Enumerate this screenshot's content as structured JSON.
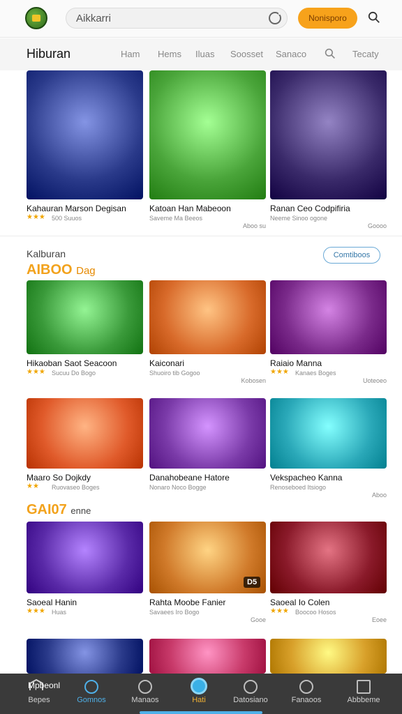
{
  "header": {
    "search_value": "Aikkarri",
    "button_label": "Nonisporo"
  },
  "nav": {
    "title": "Hiburan",
    "links": [
      "Ham",
      "Hems",
      "Iluas",
      "Soosset",
      "Sanaco",
      "Tecaty"
    ]
  },
  "row1": [
    {
      "title": "Kahauran Marson Degisan",
      "meta": "500 Suuos",
      "tag": "",
      "stars": "★★★",
      "bg": "#2a3a8a"
    },
    {
      "title": "Katoan Han Mabeoon",
      "meta": "Saveme Ma Beeos",
      "tag": "Aboo su",
      "stars": "",
      "bg": "#4aa53a"
    },
    {
      "title": "Ranan Ceo Codpifiria",
      "meta": "Neeme Sinoo ogone",
      "tag": "Goooo",
      "stars": "",
      "bg": "#3a2a6a"
    }
  ],
  "section": {
    "subtitle": "Kalburan",
    "heading": "AIBOO",
    "heading_small": "Dag",
    "button": "Comtiboos"
  },
  "row2": [
    {
      "title": "Hikaoban Saot Seacoon",
      "meta": "Sucuu Do Bogo",
      "tag": "",
      "stars": "★★★",
      "bg": "#3a9a3a"
    },
    {
      "title": "Kaiconari",
      "meta": "Shuoiro tib Gogoo",
      "tag": "Kobosen",
      "stars": "",
      "bg": "#d86a2a"
    },
    {
      "title": "Raiaio Manna",
      "meta": "Kanaes Boges",
      "tag": "Uoteoeo",
      "stars": "★★★",
      "bg": "#7a2a8a"
    }
  ],
  "row3": [
    {
      "title": "Maaro So Dojkdy",
      "meta": "Ruovaseo Boges",
      "tag": "",
      "stars": "★★",
      "bg": "#e05a2a"
    },
    {
      "title": "Danahobeane Hatore",
      "meta": "Nonaro Noco Bogge",
      "tag": "",
      "stars": "",
      "bg": "#7a3aa8"
    },
    {
      "title": "Vekspacheo Kanna",
      "meta": "Renoseboed Itsiogo",
      "tag": "Aboo",
      "stars": "",
      "bg": "#2aa8b8"
    }
  ],
  "section2": {
    "heading": "GAI07",
    "small": "enne"
  },
  "row4": [
    {
      "title": "Saoeal Hanin",
      "meta": "Huas",
      "tag": "",
      "stars": "★★★",
      "bg": "#5a2aa8"
    },
    {
      "title": "Rahta Moobe Fanier",
      "meta": "Savaees Iro Bogo",
      "tag": "Gooe",
      "stars": "",
      "bg": "#d07a2a",
      "badge": "D5"
    },
    {
      "title": "Saoeal Io Colen",
      "meta": "Boocoo Hosos",
      "tag": "Eoee",
      "stars": "★★★",
      "bg": "#8a1a2a"
    }
  ],
  "row5": [
    {
      "bg": "#2a3a8a"
    },
    {
      "bg": "#c83a6a"
    },
    {
      "bg": "#d8a02a"
    }
  ],
  "bottom": {
    "home_label": "Mpbeonl",
    "items": [
      "Bepes",
      "Gomnos",
      "Manaos",
      "Hati",
      "Datosiano",
      "Fanaoos",
      "Abbbeme"
    ]
  }
}
